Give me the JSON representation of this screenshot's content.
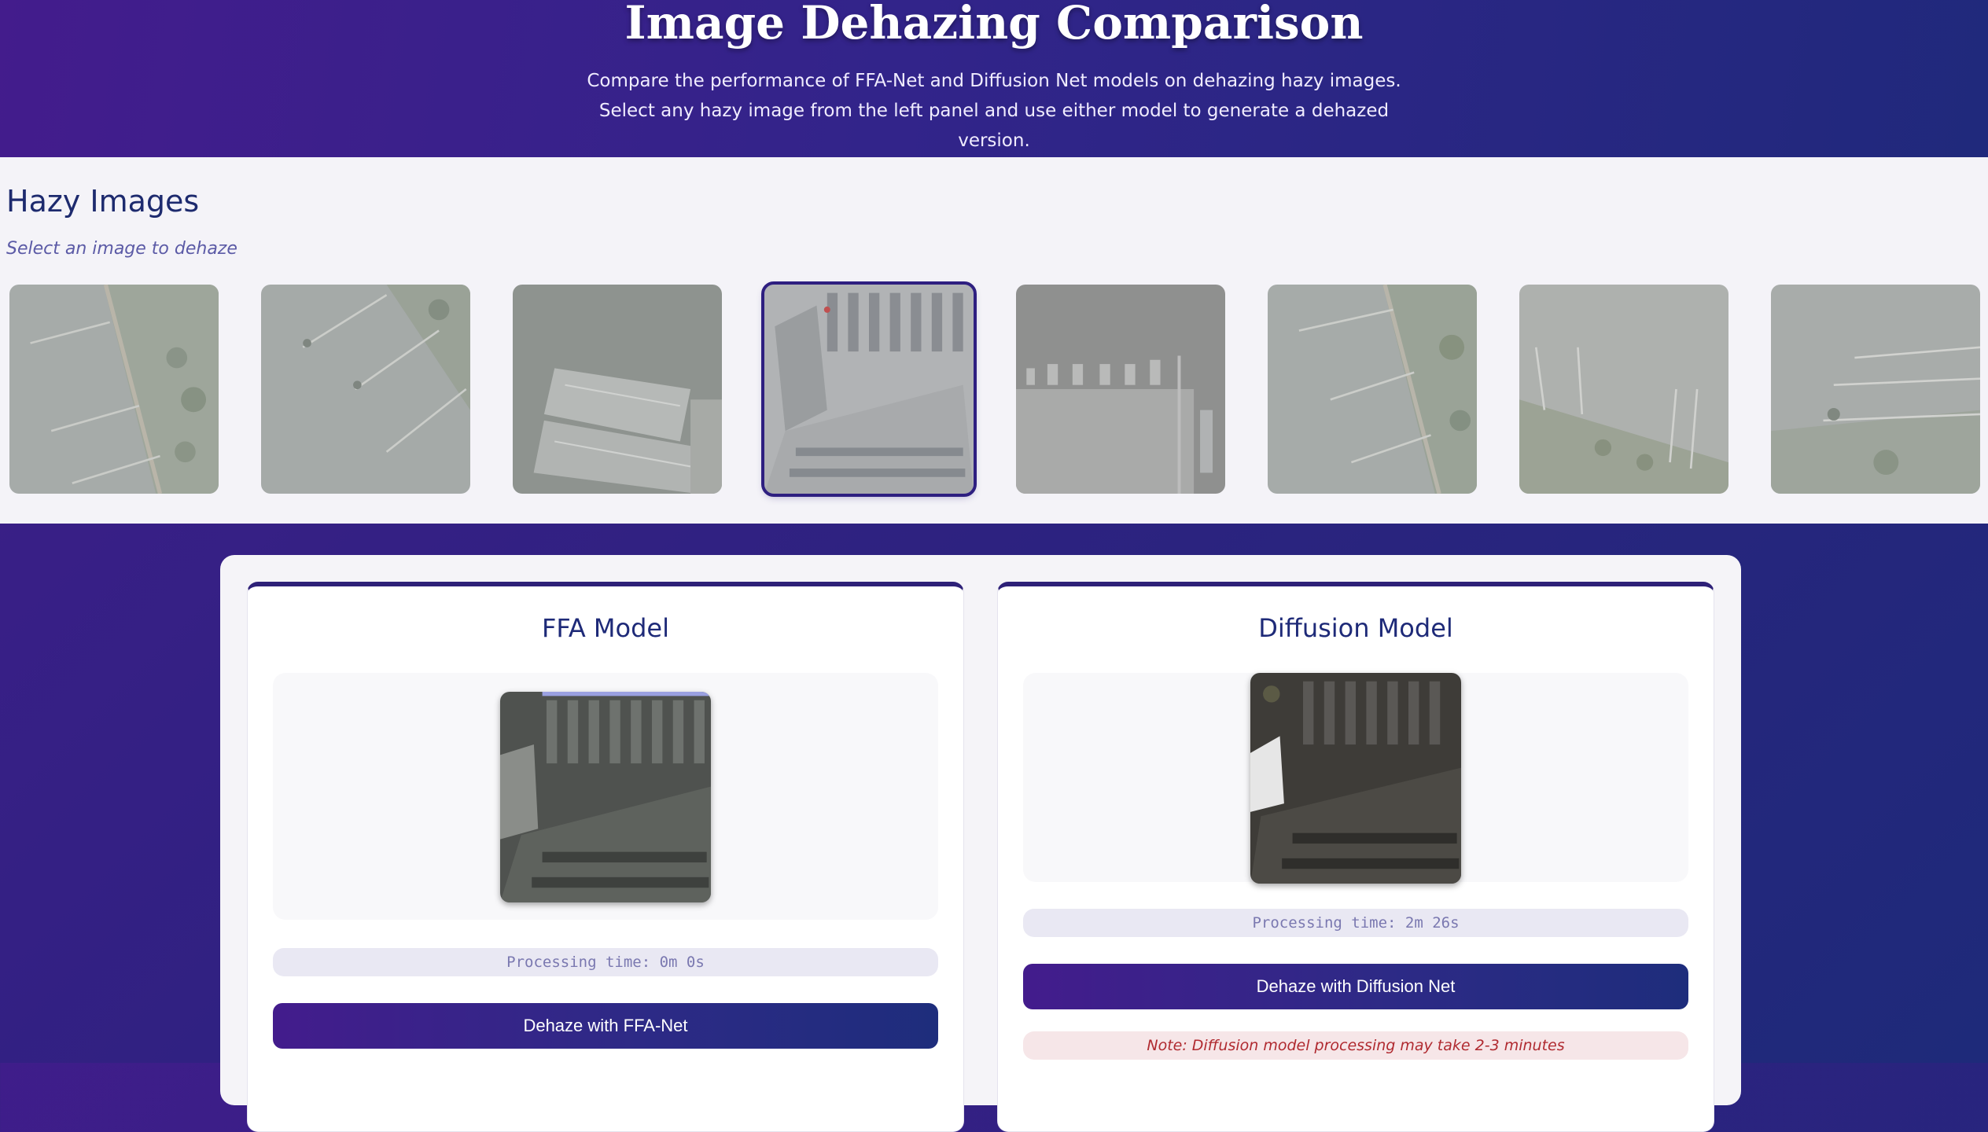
{
  "header": {
    "title": "Image Dehazing Comparison",
    "description": "Compare the performance of FFA-Net and Diffusion Net models on dehazing hazy images. Select any hazy image from the left panel and use either model to generate a dehazed version."
  },
  "hazy": {
    "title": "Hazy Images",
    "subtitle": "Select an image to dehaze",
    "thumbnails": [
      {
        "name": "hazy-image-1",
        "selected": false
      },
      {
        "name": "hazy-image-2",
        "selected": false
      },
      {
        "name": "hazy-image-3",
        "selected": false
      },
      {
        "name": "hazy-image-4",
        "selected": true
      },
      {
        "name": "hazy-image-5",
        "selected": false
      },
      {
        "name": "hazy-image-6",
        "selected": false
      },
      {
        "name": "hazy-image-7",
        "selected": false
      },
      {
        "name": "hazy-image-8",
        "selected": false
      }
    ]
  },
  "ffa": {
    "title": "FFA Model",
    "processing_time": "Processing time: 0m 0s",
    "button": "Dehaze with FFA-Net"
  },
  "diffusion": {
    "title": "Diffusion Model",
    "processing_time": "Processing time: 2m 26s",
    "button": "Dehaze with Diffusion Net",
    "note": "Note: Diffusion model processing may take 2-3 minutes"
  },
  "colors": {
    "primary": "#2e2178",
    "accent_gradient_start": "#431c8c",
    "accent_gradient_end": "#1e2d7c",
    "note_text": "#b02a30"
  }
}
